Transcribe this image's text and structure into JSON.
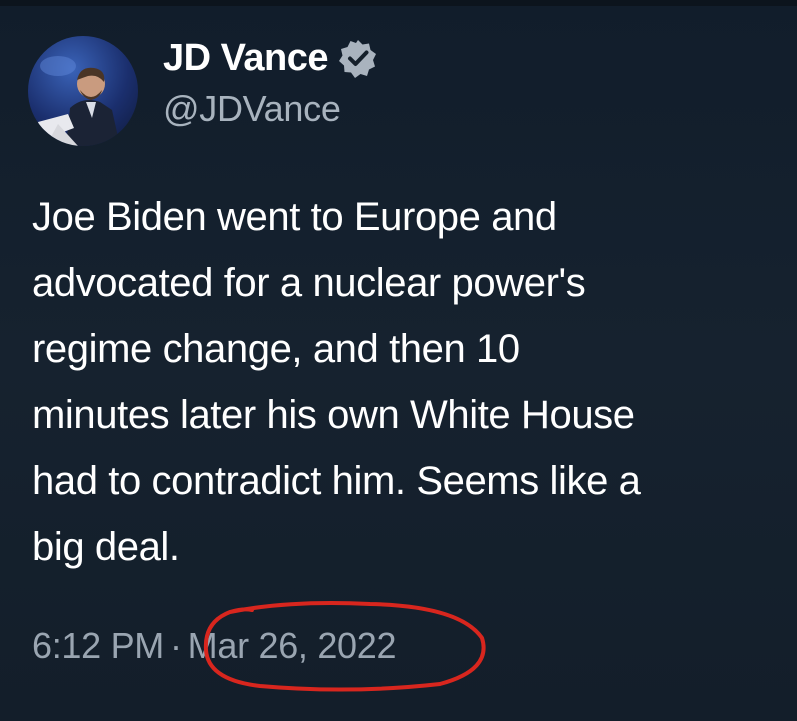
{
  "author": {
    "name": "JD Vance",
    "handle": "@JDVance",
    "verified_badge_color": "#a9b3be"
  },
  "tweet": {
    "lines": [
      "Joe Biden went to Europe and",
      "advocated for a nuclear power's",
      "regime change, and then 10",
      "minutes later his own White House",
      "had to contradict him. Seems like a",
      "big deal."
    ],
    "time": "6:12 PM",
    "separator": "·",
    "date": "Mar 26, 2022"
  },
  "annotation": {
    "color": "#d8261e"
  },
  "colors": {
    "background": "#15202b",
    "text": "#ffffff",
    "muted": "#9aa5b1"
  }
}
